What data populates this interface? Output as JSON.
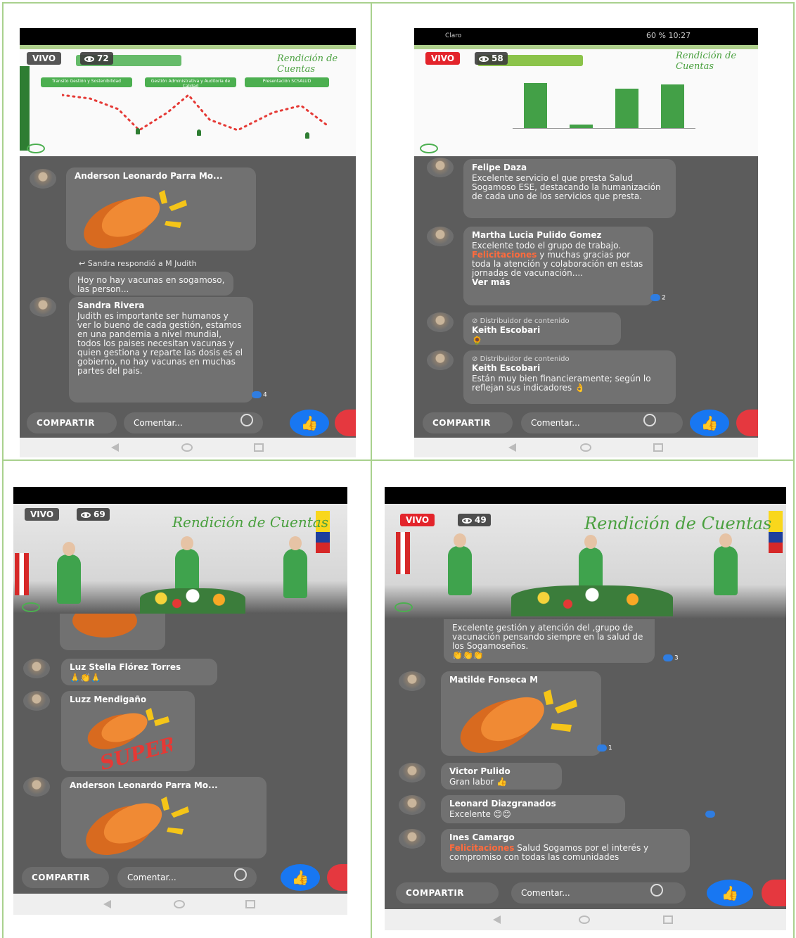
{
  "panels": [
    {
      "id": "p1",
      "status_bar": "",
      "live_label": "VIVO",
      "viewers": "72",
      "brand": "Rendición de Cuentas",
      "slide_tabs": [
        "Transito Gestión y Sostenibilidad",
        "Gestión Administrativa y Auditoria de Calidad",
        "Presentación SCSALUD"
      ],
      "comments": [
        {
          "name": "Anderson Leonardo Parra Mo...",
          "text": "",
          "sticker": "clap"
        },
        {
          "reply_note": "Sandra respondió a M Judith",
          "text": "Hoy no hay vacunas en sogamoso,  las person..."
        },
        {
          "name": "Sandra Rivera",
          "text": "Judith es importante ser humanos y ver lo bueno de cada gestión, estamos en una pandemia a nivel mundial, todos los paises necesitan vacunas y quien gestiona y reparte las dosis es el gobierno, no hay vacunas en muchas partes del pais.",
          "likes": "4"
        }
      ],
      "share_label": "COMPARTIR",
      "comment_placeholder": "Comentar..."
    },
    {
      "id": "p2",
      "status_bar_left": "Claro",
      "status_bar_right": "60 %  10:27",
      "live_label": "VIVO",
      "viewers": "58",
      "brand": "Rendición de Cuentas",
      "chart_values": [
        82,
        6,
        72,
        80
      ],
      "comments": [
        {
          "name": "Felipe Daza",
          "text": "Excelente servicio el que presta Salud Sogamoso ESE, destacando la humanización de cada uno de los servicios que presta."
        },
        {
          "name": "Martha Lucia Pulido Gomez",
          "text_a": "Excelente todo el grupo de trabajo.",
          "highlight": "Felicitaciones",
          "text_b": " y muchas gracias por toda la atención y colaboración en estas jornadas de vacunación....",
          "more": "Ver más",
          "likes": "2"
        },
        {
          "tag": "Distribuidor de contenido",
          "name": "Keith Escobari",
          "text": "🌻"
        },
        {
          "tag": "Distribuidor de contenido",
          "name": "Keith Escobari",
          "text": "Están muy bien financieramente; según lo reflejan sus indicadores 👌"
        }
      ],
      "share_label": "COMPARTIR",
      "comment_placeholder": "Comentar..."
    },
    {
      "id": "p3",
      "live_label": "VIVO",
      "viewers": "69",
      "brand": "Rendición de Cuentas",
      "comments": [
        {
          "name": "Luz Stella Flórez Torres",
          "text": "🙏👏🙏"
        },
        {
          "name": "Luzz Mendigaño",
          "sticker": "SUPER!"
        },
        {
          "name": "Anderson Leonardo Parra Mo...",
          "sticker": "clap"
        }
      ],
      "share_label": "COMPARTIR",
      "comment_placeholder": "Comentar..."
    },
    {
      "id": "p4",
      "live_label": "VIVO",
      "viewers": "49",
      "brand": "Rendición de Cuentas",
      "comments": [
        {
          "text": "Excelente gestión y atención del ,grupo de vacunación pensando siempre en la salud de los Sogamoseños.",
          "emoji": "👏👏👏",
          "likes": "3"
        },
        {
          "name": "Matilde Fonseca M",
          "sticker": "clap",
          "likes": "1"
        },
        {
          "name": "Victor Pulido",
          "text": "Gran labor 👍"
        },
        {
          "name": "Leonard Diazgranados",
          "text": "Excelente 😊😊"
        },
        {
          "name": "Ines Camargo",
          "highlight": "Felicitaciones",
          "text_b": " Salud Sogamos por el interés y compromiso con todas las comunidades"
        }
      ],
      "share_label": "COMPARTIR",
      "comment_placeholder": "Comentar..."
    }
  ],
  "colors": {
    "accent": "#1877f2",
    "live_red": "#e3242b",
    "green": "#4caf50",
    "highlight": "#ff6b3d",
    "border": "#a9d18e"
  }
}
